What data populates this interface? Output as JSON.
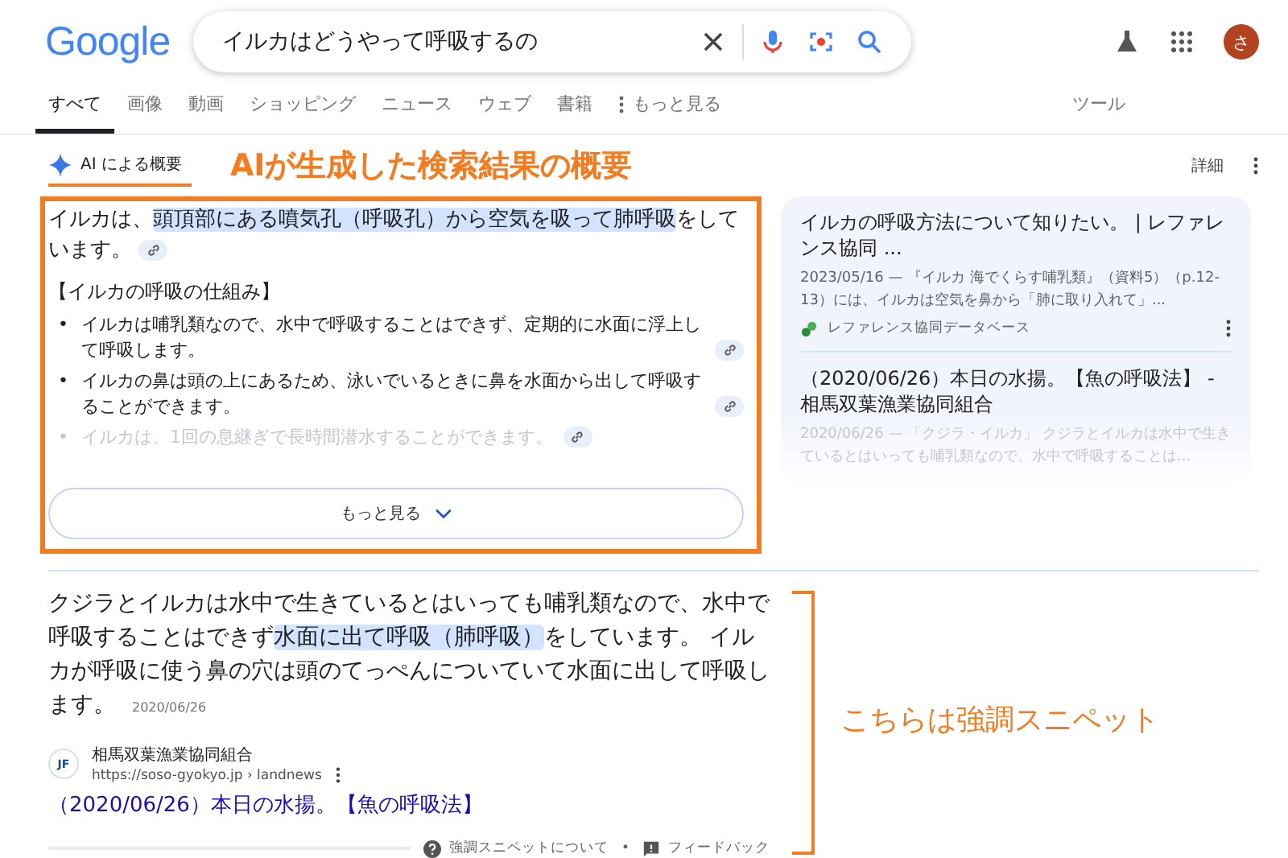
{
  "header": {
    "logo": "Google",
    "search": {
      "value": "イルカはどうやって呼吸するの"
    },
    "avatar": "さ"
  },
  "tabs": [
    {
      "label": "すべて",
      "selected": true,
      "kind": "tab"
    },
    {
      "label": "画像",
      "selected": false,
      "kind": "tab"
    },
    {
      "label": "動画",
      "selected": false,
      "kind": "tab"
    },
    {
      "label": "ショッピング",
      "selected": false,
      "kind": "tab"
    },
    {
      "label": "ニュース",
      "selected": false,
      "kind": "tab"
    },
    {
      "label": "ウェブ",
      "selected": false,
      "kind": "tab"
    },
    {
      "label": "書籍",
      "selected": false,
      "kind": "tab"
    },
    {
      "label": "もっと見る",
      "selected": false,
      "kind": "more"
    }
  ],
  "tools": "ツール",
  "ai_overview": {
    "label": "AI による概要",
    "annotation": "AIが生成した検索結果の概要",
    "details": "詳細",
    "intro": {
      "before": "イルカは、",
      "highlight": "頭頂部にある噴気孔（呼吸孔）から空気を吸って肺呼吸",
      "after": "をしています。"
    },
    "heading": "【イルカの呼吸の仕組み】",
    "bullet_marker": "•",
    "bullets": [
      {
        "text": "イルカは哺乳類なので、水中で呼吸することはできず、定期的に水面に浮上して呼吸します。",
        "faded": false
      },
      {
        "text": "イルカの鼻は頭の上にあるため、泳いでいるときに鼻を水面から出して呼吸することができます。",
        "faded": false
      },
      {
        "text": "イルカは、1回の息継ぎで長時間潜水することができます。",
        "faded": true
      }
    ],
    "more_button": "もっと見る",
    "sources": [
      {
        "title": "イルカの呼吸方法について知りたい。 | レファレンス協同 ...",
        "snippet": "2023/05/16 — 『イルカ 海でくらす哺乳類』（資料5）（p.12-13）には、イルカは空気を鼻から「肺に取り入れて」...",
        "site": "レファレンス協同データベース",
        "faded": false
      },
      {
        "title": "（2020/06/26）本日の水揚。【魚の呼吸法】 - 相馬双葉漁業協同組合",
        "snippet": "2020/06/26 — 「クジラ・イルカ」 クジラとイルカは水中で生きているとはいっても哺乳類なので、水中で呼吸することは...",
        "faded": true
      }
    ]
  },
  "featured_snippet": {
    "text": {
      "before": "クジラとイルカは水中で生きているとはいっても哺乳類なので、水中で呼吸することはできず",
      "highlight": "水面に出て呼吸（肺呼吸）",
      "after": "をしています。 イルカが呼吸に使う鼻の穴は頭のてっぺんについていて水面に出して呼吸します。"
    },
    "date": "2020/06/26",
    "site_logo": "JF",
    "footer_separator": "•",
    "site_name": "相馬双葉漁業協同組合",
    "url": "https://soso-gyokyo.jp › landnews",
    "title": "（2020/06/26）本日の水揚。【魚の呼吸法】",
    "footer": [
      {
        "label": "強調スニペットについて",
        "kind": "help"
      },
      {
        "label": "フィードバック",
        "kind": "feedback"
      }
    ],
    "annotation": "こちらは強調スニペット"
  }
}
